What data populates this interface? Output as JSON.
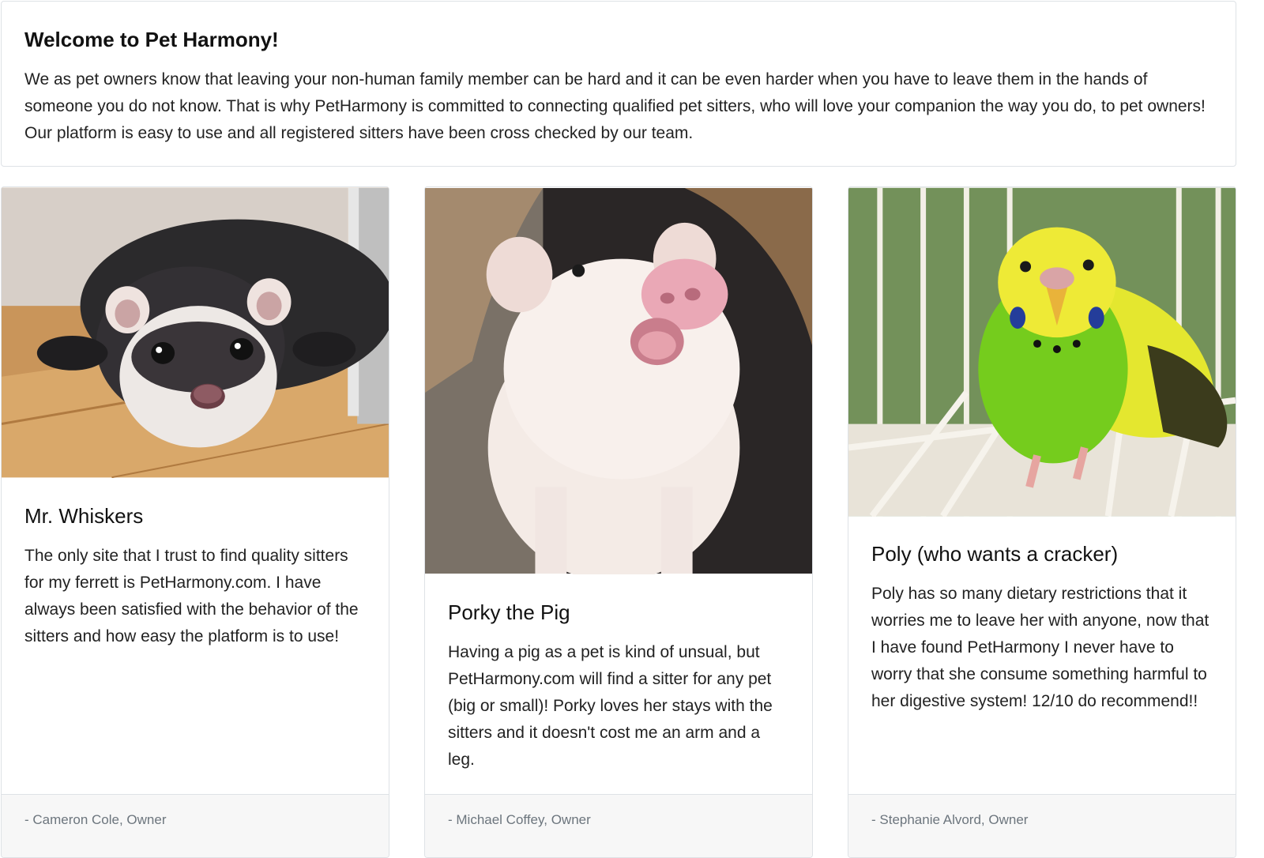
{
  "welcome": {
    "title": "Welcome to Pet Harmony!",
    "text": "We as pet owners know that leaving your non-human family member can be hard and it can be even harder when you have to leave them in the hands of someone you do not know. That is why PetHarmony is committed to connecting qualified pet sitters, who will love your companion the way you do, to pet owners! Our platform is easy to use and all registered sitters have been cross checked by our team."
  },
  "cards": [
    {
      "title": "Mr. Whiskers",
      "text": "The only site that I trust to find quality sitters for my ferrett is PetHarmony.com. I have always been satisfied with the behavior of the sitters and how easy the platform is to use!",
      "footer": "- Cameron Cole, Owner"
    },
    {
      "title": "Porky the Pig",
      "text": "Having a pig as a pet is kind of unsual, but PetHarmony.com will find a sitter for any pet (big or small)! Porky loves her stays with the sitters and it doesn't cost me an arm and a leg.",
      "footer": "- Michael Coffey, Owner"
    },
    {
      "title": "Poly (who wants a cracker)",
      "text": "Poly has so many dietary restrictions that it worries me to leave her with anyone, now that I have found PetHarmony I never have to worry that she consume something harmful to her digestive system! 12/10 do recommend!!",
      "footer": "- Stephanie Alvord, Owner"
    }
  ],
  "colors": {
    "border": "#dee2e6",
    "footer_bg": "#f7f7f7",
    "footer_text": "#6c757d"
  }
}
